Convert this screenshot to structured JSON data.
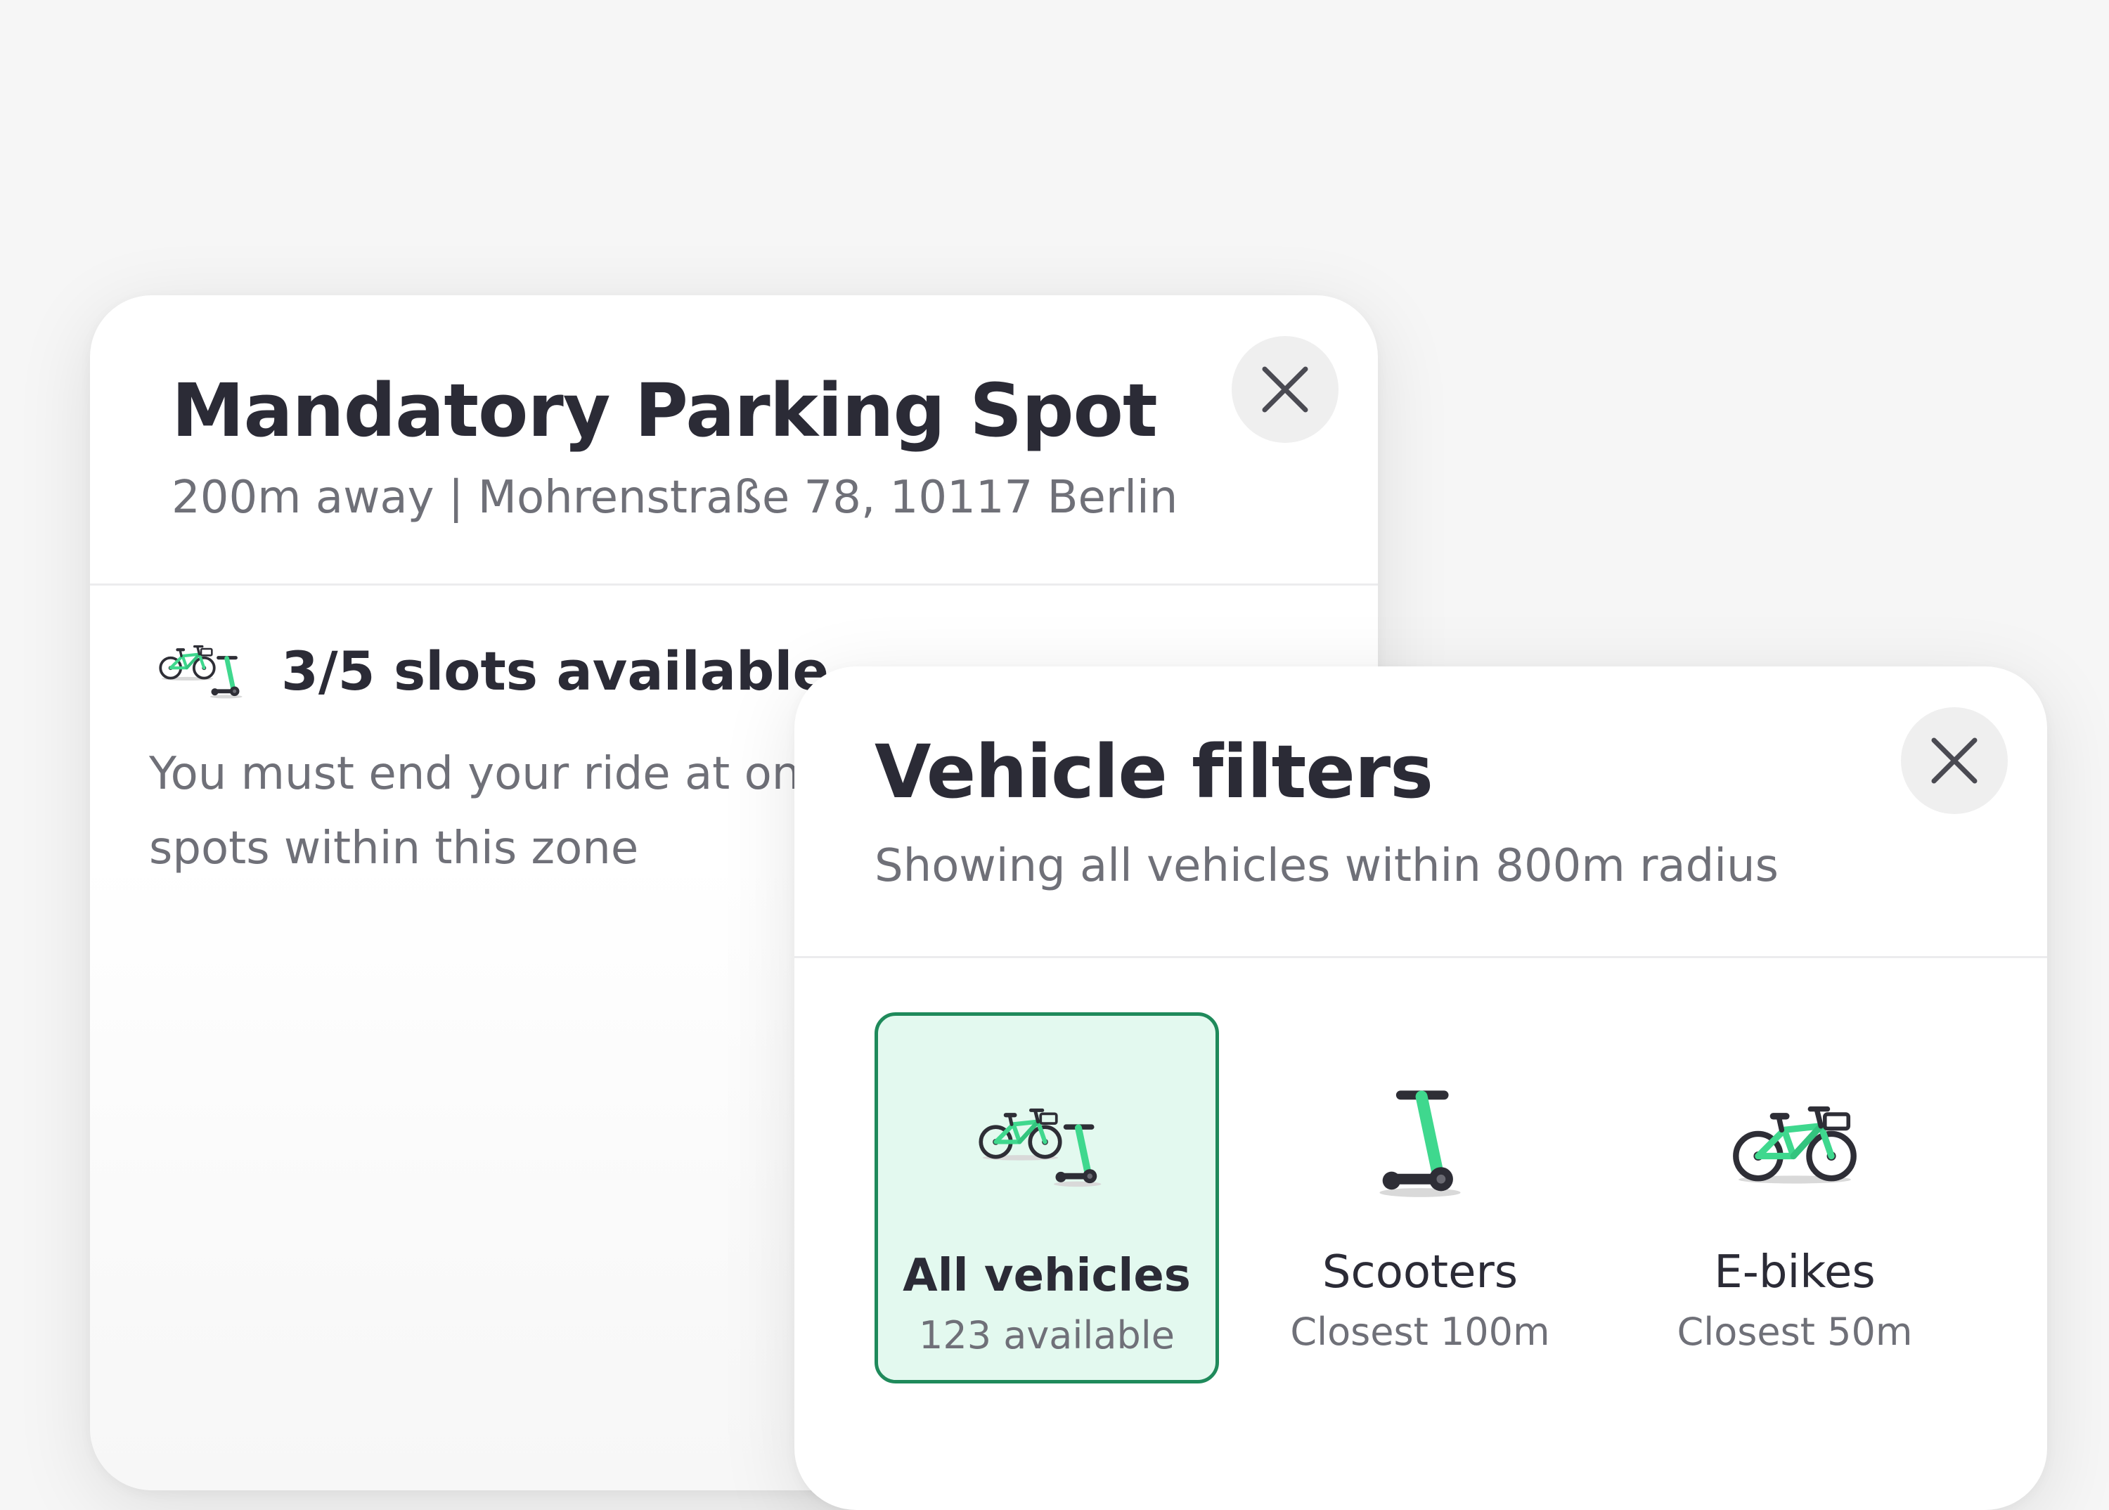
{
  "parking_card": {
    "title": "Mandatory Parking Spot",
    "subtitle": "200m away | Mohrenstraße 78, 10117 Berlin",
    "slots": "3/5 slots available",
    "description_line1": "You must end your ride at one of the",
    "description_line2": "spots within this zone",
    "icon": "bike-and-scooter-icon"
  },
  "filters_card": {
    "title": "Vehicle filters",
    "subtitle": "Showing all vehicles within 800m radius",
    "options": [
      {
        "label": "All vehicles",
        "sub": "123 available",
        "selected": true,
        "icon": "bike-and-scooter-icon"
      },
      {
        "label": "Scooters",
        "sub": "Closest 100m",
        "selected": false,
        "icon": "scooter-icon"
      },
      {
        "label": "E-bikes",
        "sub": "Closest 50m",
        "selected": false,
        "icon": "ebike-icon"
      }
    ]
  },
  "colors": {
    "accent_green": "#3fd88e",
    "selected_border": "#1f8a5b",
    "selected_bg": "#e3f9ef",
    "text_primary": "#2b2b36",
    "text_secondary": "#6f7078"
  }
}
